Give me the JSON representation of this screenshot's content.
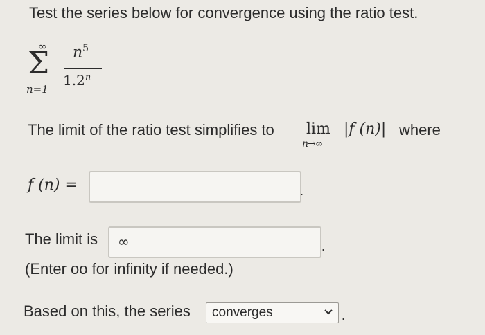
{
  "prompt": "Test the series below for convergence using the ratio test.",
  "series": {
    "sum_upper": "∞",
    "sum_symbol": "Σ",
    "sum_lower": "n=1",
    "numerator": "n",
    "numerator_exp": "5",
    "denominator": "1.2",
    "denominator_exp": "n"
  },
  "ratio_line": {
    "text": "The limit of the ratio test simplifies to",
    "lim": "lim",
    "lim_sub": "n→∞",
    "expr": "|f (n)|",
    "where": "where"
  },
  "fn_field": {
    "label": "f (n) =",
    "value": ""
  },
  "limit_field": {
    "label": "The limit is",
    "value": "∞"
  },
  "hint": "(Enter oo for infinity if needed.)",
  "conclusion": {
    "label": "Based on this, the series",
    "selected": "converges",
    "icon": "chevron-down-icon"
  },
  "punctuation": "."
}
